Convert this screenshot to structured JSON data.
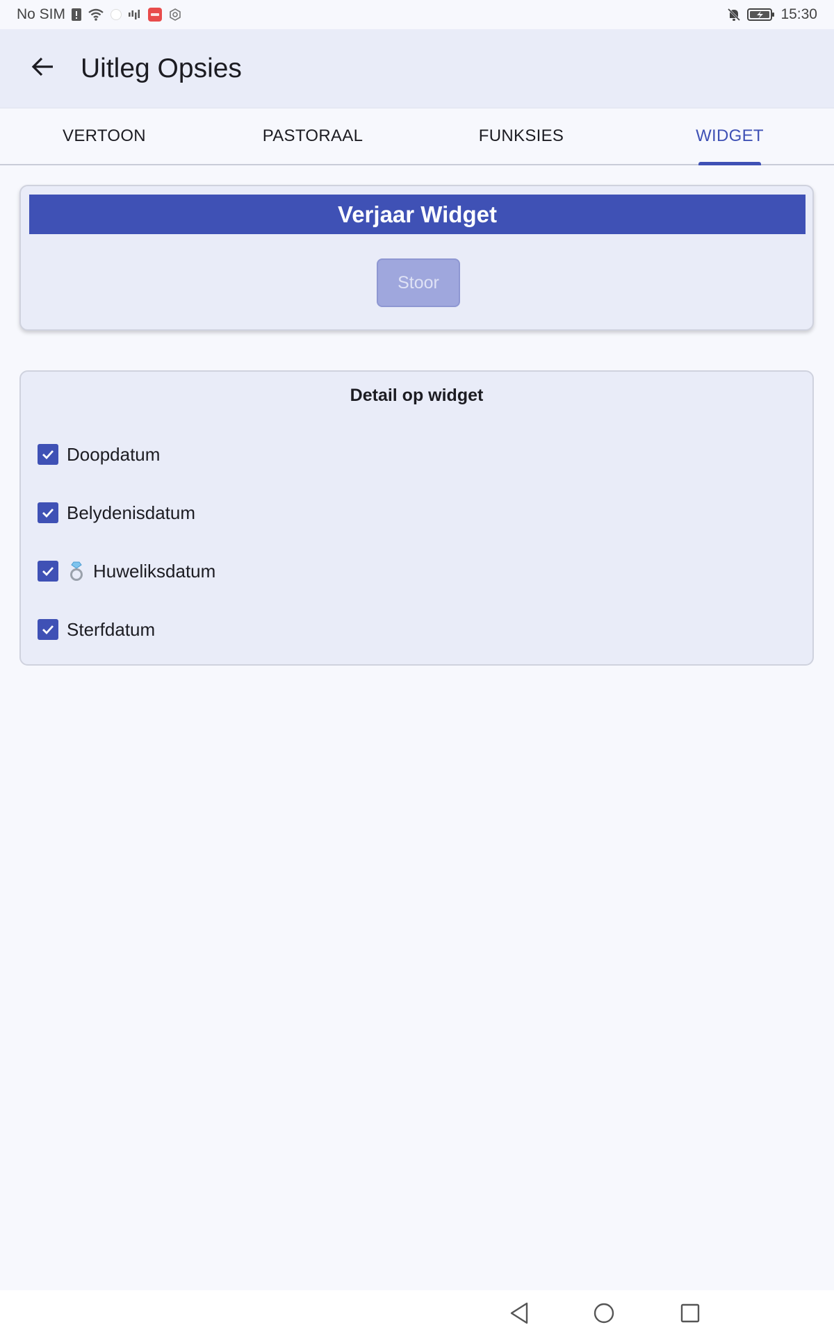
{
  "status_bar": {
    "carrier": "No SIM",
    "time": "15:30",
    "icons": [
      "sim-alert-icon",
      "wifi-icon",
      "signal-icon",
      "notification-app-icon",
      "vpn-icon",
      "mute-bell-icon",
      "battery-charging-icon"
    ]
  },
  "app_bar": {
    "title": "Uitleg Opsies",
    "back_icon": "arrow-left-icon"
  },
  "tabs": [
    {
      "label": "VERTOON",
      "active": false
    },
    {
      "label": "PASTORAAL",
      "active": false
    },
    {
      "label": "FUNKSIES",
      "active": false
    },
    {
      "label": "WIDGET",
      "active": true
    }
  ],
  "widget_card": {
    "header": "Verjaar Widget",
    "save_label": "Stoor"
  },
  "detail_card": {
    "title": "Detail op widget",
    "options": [
      {
        "label": "Doopdatum",
        "checked": true,
        "icon": null
      },
      {
        "label": "Belydenisdatum",
        "checked": true,
        "icon": null
      },
      {
        "label": "Huweliksdatum",
        "checked": true,
        "icon": "ring-icon"
      },
      {
        "label": "Sterfdatum",
        "checked": true,
        "icon": null
      }
    ]
  },
  "nav_bar": {
    "icons": [
      "back-triangle-icon",
      "home-circle-icon",
      "recents-square-icon"
    ]
  },
  "colors": {
    "accent": "#3f51b5",
    "background": "#f7f8fd",
    "card": "#e9ecf8",
    "disabled_button": "#9fa7dd"
  }
}
